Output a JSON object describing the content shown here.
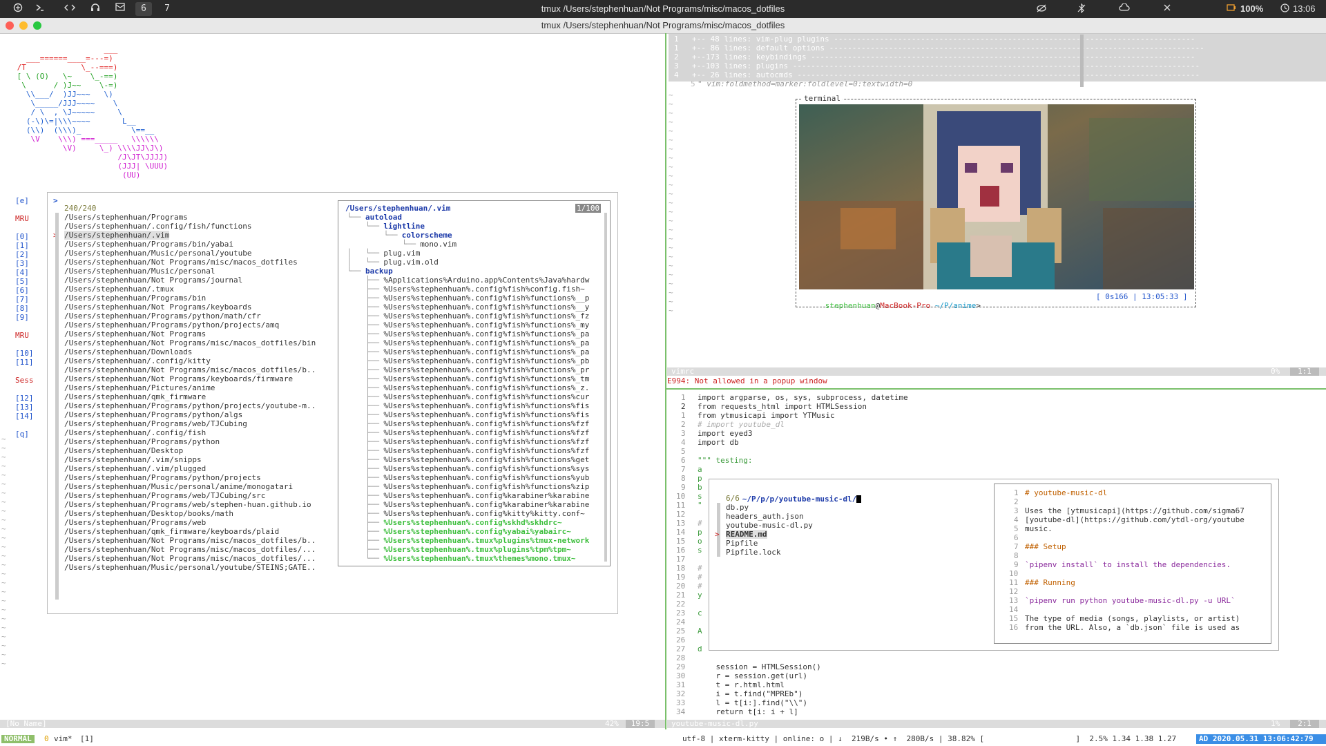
{
  "menubar": {
    "workspaces": [
      "6",
      "7"
    ],
    "title": "tmux /Users/stephenhuan/Not Programs/misc/macos_dotfiles",
    "battery": "100%",
    "clock": "13:06"
  },
  "window": {
    "title": "tmux /Users/stephenhuan/Not Programs/misc/macos_dotfiles"
  },
  "startify": {
    "ascii_art": [
      "                    ___",
      "   ___======____=---=)",
      " /T            \\_--===)",
      " [ \\ (O)   \\~    \\_-==)",
      "  \\      / )J~~    \\-=)",
      "   \\\\___/  )JJ~~~   \\)",
      "    \\_____/JJJ~~~~    \\",
      "    / \\  , \\J~~~~~     \\",
      "   (-\\)\\=|\\\\\\~~~~       L__",
      "   (\\\\)  (\\\\\\)_           \\==__",
      "    \\V    \\\\\\) ===_____   \\\\\\\\\\\\",
      "           \\V)     \\_) \\\\\\\\JJ\\J\\)",
      "                       /J\\JT\\JJJJ)",
      "                       (JJJ| \\UUU)",
      "                        (UU)"
    ],
    "left_labels": [
      {
        "t": "[e]",
        "row": 0
      },
      {
        "t": "MRU",
        "row": 2
      },
      {
        "t": "[0]",
        "row": 4
      },
      {
        "t": "[1]",
        "row": 5
      },
      {
        "t": "[2]",
        "row": 6
      },
      {
        "t": "[3]",
        "row": 7
      },
      {
        "t": "[4]",
        "row": 8
      },
      {
        "t": "[5]",
        "row": 9
      },
      {
        "t": "[6]",
        "row": 10
      },
      {
        "t": "[7]",
        "row": 11
      },
      {
        "t": "[8]",
        "row": 12
      },
      {
        "t": "[9]",
        "row": 13
      },
      {
        "t": "MRU",
        "row": 15
      },
      {
        "t": "[10]",
        "row": 17
      },
      {
        "t": "[11]",
        "row": 18
      },
      {
        "t": "Sess",
        "row": 20
      },
      {
        "t": "[12]",
        "row": 22
      },
      {
        "t": "[13]",
        "row": 23
      },
      {
        "t": "[14]",
        "row": 24
      },
      {
        "t": "[q]",
        "row": 26
      }
    ]
  },
  "fzf": {
    "prompt": ">",
    "count": "240/240",
    "items": [
      "/Users/stephenhuan/Programs",
      "/Users/stephenhuan/.config/fish/functions",
      "/Users/stephenhuan/.vim",
      "/Users/stephenhuan/Programs/bin/yabai",
      "/Users/stephenhuan/Music/personal/youtube",
      "/Users/stephenhuan/Not Programs/misc/macos_dotfiles",
      "/Users/stephenhuan/Music/personal",
      "/Users/stephenhuan/Not Programs/journal",
      "/Users/stephenhuan/.tmux",
      "/Users/stephenhuan/Programs/bin",
      "/Users/stephenhuan/Not Programs/keyboards",
      "/Users/stephenhuan/Programs/python/math/cfr",
      "/Users/stephenhuan/Programs/python/projects/amq",
      "/Users/stephenhuan/Not Programs",
      "/Users/stephenhuan/Not Programs/misc/macos_dotfiles/bin",
      "/Users/stephenhuan/Downloads",
      "/Users/stephenhuan/.config/kitty",
      "/Users/stephenhuan/Not Programs/misc/macos_dotfiles/b..",
      "/Users/stephenhuan/Not Programs/keyboards/firmware",
      "/Users/stephenhuan/Pictures/anime",
      "/Users/stephenhuan/qmk_firmware",
      "/Users/stephenhuan/Programs/python/projects/youtube-m..",
      "/Users/stephenhuan/Programs/python/algs",
      "/Users/stephenhuan/Programs/web/TJCubing",
      "/Users/stephenhuan/.config/fish",
      "/Users/stephenhuan/Programs/python",
      "/Users/stephenhuan/Desktop",
      "/Users/stephenhuan/.vim/snipps",
      "/Users/stephenhuan/.vim/plugged",
      "/Users/stephenhuan/Programs/python/projects",
      "/Users/stephenhuan/Music/personal/anime/monogatari",
      "/Users/stephenhuan/Programs/web/TJCubing/src",
      "/Users/stephenhuan/Programs/web/stephen-huan.github.io",
      "/Users/stephenhuan/Desktop/books/math",
      "/Users/stephenhuan/Programs/web",
      "/Users/stephenhuan/qmk_firmware/keyboards/plaid",
      "/Users/stephenhuan/Not Programs/misc/macos_dotfiles/b..",
      "/Users/stephenhuan/Not Programs/misc/macos_dotfiles/...",
      "/Users/stephenhuan/Not Programs/misc/macos_dotfiles/...",
      "/Users/stephenhuan/Music/personal/youtube/STEINS;GATE.."
    ],
    "preview_path": "/Users/stephenhuan/.vim",
    "preview_count": "1/100",
    "tree": [
      {
        "t": "autoload",
        "c": "navy",
        "pre": " └── "
      },
      {
        "t": "lightline",
        "c": "navy",
        "pre": "     └── "
      },
      {
        "t": "colorscheme",
        "c": "navy",
        "pre": "         └── "
      },
      {
        "t": "mono.vim",
        "c": "",
        "pre": "             └── "
      },
      {
        "t": "plug.vim",
        "c": "",
        "pre": " │   └── "
      },
      {
        "t": "plug.vim.old",
        "c": "",
        "pre": " │   └── "
      },
      {
        "t": "backup",
        "c": "navy",
        "pre": " └── "
      },
      {
        "t": "%Applications%Arduino.app%Contents%Java%hardw",
        "c": "",
        "pre": "     ├── "
      },
      {
        "t": "%Users%stephenhuan%.config%fish%config.fish~",
        "c": "",
        "pre": "     ├── "
      },
      {
        "t": "%Users%stephenhuan%.config%fish%functions%__p",
        "c": "",
        "pre": "     ├── "
      },
      {
        "t": "%Users%stephenhuan%.config%fish%functions%__y",
        "c": "",
        "pre": "     ├── "
      },
      {
        "t": "%Users%stephenhuan%.config%fish%functions%_fz",
        "c": "",
        "pre": "     ├── "
      },
      {
        "t": "%Users%stephenhuan%.config%fish%functions%_my",
        "c": "",
        "pre": "     ├── "
      },
      {
        "t": "%Users%stephenhuan%.config%fish%functions%_pa",
        "c": "",
        "pre": "     ├── "
      },
      {
        "t": "%Users%stephenhuan%.config%fish%functions%_pa",
        "c": "",
        "pre": "     ├── "
      },
      {
        "t": "%Users%stephenhuan%.config%fish%functions%_pa",
        "c": "",
        "pre": "     ├── "
      },
      {
        "t": "%Users%stephenhuan%.config%fish%functions%_pb",
        "c": "",
        "pre": "     ├── "
      },
      {
        "t": "%Users%stephenhuan%.config%fish%functions%_pr",
        "c": "",
        "pre": "     ├── "
      },
      {
        "t": "%Users%stephenhuan%.config%fish%functions%_tm",
        "c": "",
        "pre": "     ├── "
      },
      {
        "t": "%Users%stephenhuan%.config%fish%functions%_z.",
        "c": "",
        "pre": "     ├── "
      },
      {
        "t": "%Users%stephenhuan%.config%fish%functions%cur",
        "c": "",
        "pre": "     ├── "
      },
      {
        "t": "%Users%stephenhuan%.config%fish%functions%fis",
        "c": "",
        "pre": "     ├── "
      },
      {
        "t": "%Users%stephenhuan%.config%fish%functions%fis",
        "c": "",
        "pre": "     ├── "
      },
      {
        "t": "%Users%stephenhuan%.config%fish%functions%fzf",
        "c": "",
        "pre": "     ├── "
      },
      {
        "t": "%Users%stephenhuan%.config%fish%functions%fzf",
        "c": "",
        "pre": "     ├── "
      },
      {
        "t": "%Users%stephenhuan%.config%fish%functions%fzf",
        "c": "",
        "pre": "     ├── "
      },
      {
        "t": "%Users%stephenhuan%.config%fish%functions%fzf",
        "c": "",
        "pre": "     ├── "
      },
      {
        "t": "%Users%stephenhuan%.config%fish%functions%get",
        "c": "",
        "pre": "     ├── "
      },
      {
        "t": "%Users%stephenhuan%.config%fish%functions%sys",
        "c": "",
        "pre": "     ├── "
      },
      {
        "t": "%Users%stephenhuan%.config%fish%functions%yub",
        "c": "",
        "pre": "     ├── "
      },
      {
        "t": "%Users%stephenhuan%.config%fish%functions%zip",
        "c": "",
        "pre": "     ├── "
      },
      {
        "t": "%Users%stephenhuan%.config%karabiner%karabine",
        "c": "",
        "pre": "     ├── "
      },
      {
        "t": "%Users%stephenhuan%.config%karabiner%karabine",
        "c": "",
        "pre": "     ├── "
      },
      {
        "t": "%Users%stephenhuan%.config%kitty%kitty.conf~",
        "c": "",
        "pre": "     ├── "
      },
      {
        "t": "%Users%stephenhuan%.config%skhd%skhdrc~",
        "c": "green",
        "pre": "     ├── "
      },
      {
        "t": "%Users%stephenhuan%.config%yabai%yabairc~",
        "c": "green",
        "pre": "     ├── "
      },
      {
        "t": "%Users%stephenhuan%.tmux%plugins%tmux-network",
        "c": "green",
        "pre": "     ├── "
      },
      {
        "t": "%Users%stephenhuan%.tmux%plugins%tpm%tpm~",
        "c": "green",
        "pre": "     ├── "
      },
      {
        "t": "%Users%stephenhuan%.tmux%themes%mono.tmux~",
        "c": "green",
        "pre": "     └── "
      }
    ]
  },
  "left_status": {
    "name": "[No Name]",
    "percent": "42%",
    "pos": "19:5"
  },
  "vimrc": {
    "folds": [
      {
        "n": "1",
        "t": "+-- 48 lines: vim-plug plugins -------------------------------------------------------------------------------"
      },
      {
        "n": "1",
        "t": "+-- 86 lines: default options ----------------------------------------------------------------------------------"
      },
      {
        "n": "2",
        "t": "+--173 lines: keybindings ------------------------------------------------------------------------------------"
      },
      {
        "n": "3",
        "t": "+--103 lines: plugins -----------------------------------------------------------------------------------------"
      },
      {
        "n": "4",
        "t": "+-- 26 lines: autocmds ----------------------------------------------------------------------------------------"
      }
    ],
    "modeline_n": "5",
    "modeline": "\" vim:foldmethod=marker:foldlevel=0:textwidth=0",
    "terminal_label": "terminal",
    "prompt_user": "stephenhuan",
    "prompt_at": "@",
    "prompt_host": "MacBook-Pro",
    "prompt_path": " ~/P/anime",
    "prompt_gt": ">",
    "prompt_time": "[ 0s166 | 13:05:33 ]",
    "status_name": "vimrc",
    "status_pct": "0%",
    "status_pos": "1:1",
    "error": "E994: Not allowed in a popup window"
  },
  "code": {
    "lines": [
      {
        "n": "1",
        "t": "import argparse, os, sys, subprocess, datetime"
      },
      {
        "n": "2",
        "t": "from requests_html import HTMLSession"
      },
      {
        "n": "1",
        "t": "from ytmusicapi import YTMusic"
      },
      {
        "n": "2",
        "t": "# import youtube_dl"
      },
      {
        "n": "3",
        "t": "import eyed3"
      },
      {
        "n": "4",
        "t": "import db"
      },
      {
        "n": "5",
        "t": ""
      },
      {
        "n": "6",
        "t": "\"\"\" testing:"
      },
      {
        "n": "7",
        "t": "a"
      },
      {
        "n": "8",
        "t": "p"
      },
      {
        "n": "9",
        "t": "b"
      },
      {
        "n": "10",
        "t": "s"
      },
      {
        "n": "11",
        "t": "\""
      },
      {
        "n": "12",
        "t": ""
      },
      {
        "n": "13",
        "t": "#"
      },
      {
        "n": "14",
        "t": "p"
      },
      {
        "n": "15",
        "t": "o"
      },
      {
        "n": "16",
        "t": "s"
      },
      {
        "n": "17",
        "t": ""
      },
      {
        "n": "18",
        "t": "#"
      },
      {
        "n": "19",
        "t": "#"
      },
      {
        "n": "20",
        "t": "#"
      },
      {
        "n": "21",
        "t": "y"
      },
      {
        "n": "22",
        "t": ""
      },
      {
        "n": "23",
        "t": "c"
      },
      {
        "n": "24",
        "t": ""
      },
      {
        "n": "25",
        "t": "A"
      },
      {
        "n": "26",
        "t": ""
      },
      {
        "n": "27",
        "t": "d"
      },
      {
        "n": "28",
        "t": ""
      },
      {
        "n": "29",
        "t": "    session = HTMLSession()"
      },
      {
        "n": "30",
        "t": "    r = session.get(url)"
      },
      {
        "n": "31",
        "t": "    t = r.html.html"
      },
      {
        "n": "32",
        "t": "    i = t.find(\"MPREb\")"
      },
      {
        "n": "33",
        "t": "    l = t[i:].find(\"\\\\\")"
      },
      {
        "n": "34",
        "t": "    return t[i: i + l]"
      }
    ],
    "status_name": "youtube-music-dl.py",
    "status_pct": "1%",
    "status_pos": "2:1"
  },
  "popup": {
    "path": "~/P/p/p/youtube-music-dl/",
    "count": "6/6",
    "files": [
      "db.py",
      "headers_auth.json",
      "youtube-music-dl.py",
      "README.md",
      "Pipfile",
      "Pipfile.lock"
    ],
    "readme": [
      {
        "n": "1",
        "t": "# youtube-music-dl"
      },
      {
        "n": "2",
        "t": ""
      },
      {
        "n": "3",
        "t": "Uses the [ytmusicapi](https://github.com/sigma67"
      },
      {
        "n": "4",
        "t": "[youtube-dl](https://github.com/ytdl-org/youtube"
      },
      {
        "n": "5",
        "t": "music."
      },
      {
        "n": "6",
        "t": ""
      },
      {
        "n": "7",
        "t": "### Setup"
      },
      {
        "n": "8",
        "t": ""
      },
      {
        "n": "9",
        "t": "`pipenv install` to install the dependencies."
      },
      {
        "n": "10",
        "t": ""
      },
      {
        "n": "11",
        "t": "### Running"
      },
      {
        "n": "12",
        "t": ""
      },
      {
        "n": "13",
        "t": "`pipenv run python youtube-music-dl.py -u URL`"
      },
      {
        "n": "14",
        "t": ""
      },
      {
        "n": "15",
        "t": "The type of media (songs, playlists, or artist)"
      },
      {
        "n": "16",
        "t": "from the URL. Also, a `db.json` file is used as"
      }
    ]
  },
  "tmux": {
    "mode": "NORMAL",
    "session": "0",
    "window": "vim*",
    "window_idx": "[1]",
    "right": "utf-8 | xterm-kitty | online: o | ↓  219B/s • ↑  280B/s | 38.82% [                    ]  2.5% 1.34 1.38 1.27",
    "date": "AD 2020.05.31 13:06:42:79"
  },
  "colors": {
    "accent_green": "#7ac06b",
    "mode_green": "#8fbf6a",
    "date_blue": "#3a8ee6"
  }
}
